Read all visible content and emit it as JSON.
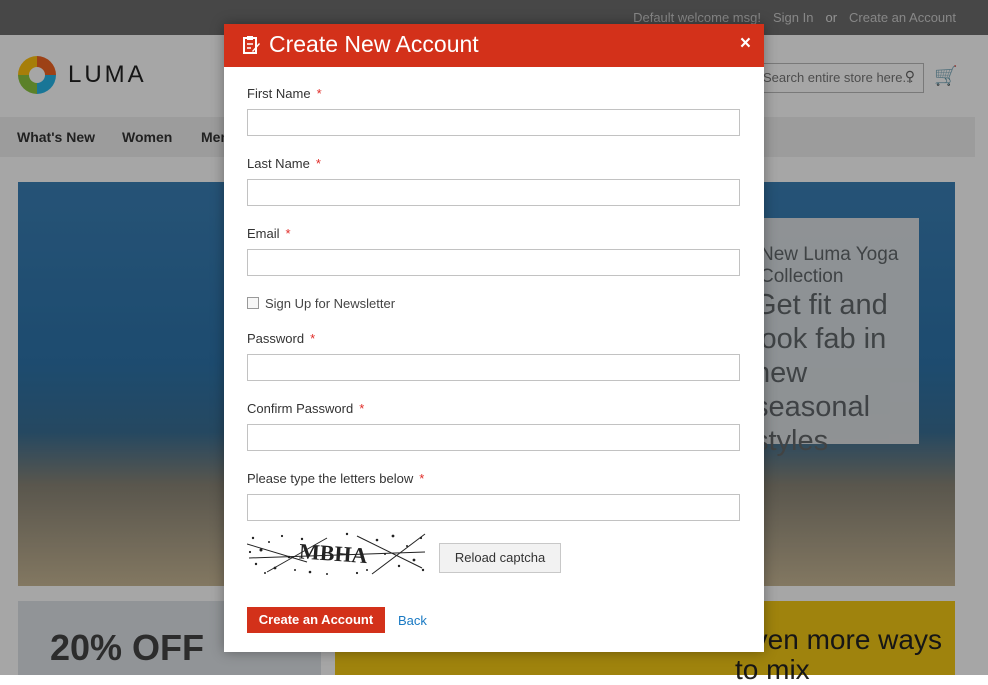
{
  "page": {
    "header_links": {
      "welcome": "Default welcome msg!",
      "sign_in": "Sign In",
      "or": "or",
      "create_account": "Create an Account"
    },
    "logo_text": "LUMA",
    "search_placeholder": "Search entire store here...",
    "nav": [
      "What's New",
      "Women",
      "Men"
    ],
    "hero": {
      "line1": "New Luma Yoga Collection",
      "line2": "Get fit and look fab in new seasonal styles"
    },
    "promo_left": "20% OFF",
    "promo_right": "Even more ways to mix"
  },
  "modal": {
    "title": "Create New Account",
    "close_glyph": "×",
    "fields": {
      "first_name": {
        "label": "First Name",
        "value": ""
      },
      "last_name": {
        "label": "Last Name",
        "value": ""
      },
      "email": {
        "label": "Email",
        "value": ""
      },
      "password": {
        "label": "Password",
        "value": ""
      },
      "confirm_password": {
        "label": "Confirm Password",
        "value": ""
      },
      "captcha": {
        "label": "Please type the letters below",
        "value": ""
      }
    },
    "required_mark": "*",
    "newsletter_label": "Sign Up for Newsletter",
    "newsletter_checked": false,
    "captcha_text": "MBHA",
    "reload_label": "Reload captcha",
    "submit_label": "Create an Account",
    "back_label": "Back"
  },
  "colors": {
    "accent": "#d3311a",
    "link": "#1979c3",
    "required": "#e02b27"
  }
}
